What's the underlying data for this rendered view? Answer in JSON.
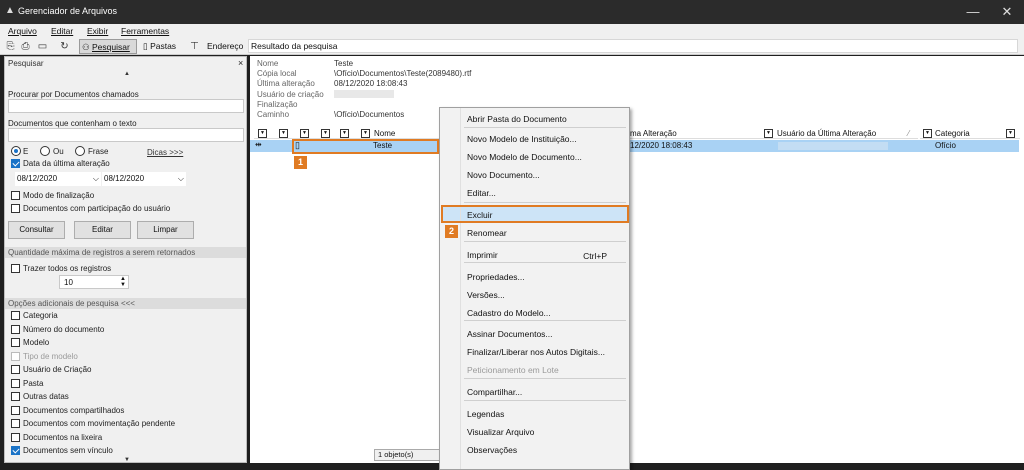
{
  "window": {
    "title": "Gerenciador de Arquivos"
  },
  "menubar": [
    "Arquivo",
    "Editar",
    "Exibir",
    "Ferramentas"
  ],
  "toolbar": {
    "search_label": "Pesquisar",
    "folders_label": "Pastas",
    "address_label": "Endereço",
    "address_value": "Resultado da pesquisa"
  },
  "search_panel": {
    "title": "Pesquisar",
    "close": "×",
    "name_label": "Procurar por Documentos chamados",
    "text_label": "Documentos que contenham o texto",
    "radio_and": "E",
    "radio_or": "Ou",
    "radio_phrase": "Frase",
    "tips": "Dicas >>>",
    "date_check": "Data da última alteração",
    "date_from": "08/12/2020",
    "date_to": "08/12/2020",
    "finalization_mode": "Modo de finalização",
    "user_docs": "Documentos com participação do usuário",
    "btn_query": "Consultar",
    "btn_edit": "Editar",
    "btn_clear": "Limpar",
    "max_records_title": "Quantidade máxima de registros a serem retornados",
    "all_records": "Trazer todos os registros",
    "max_records_value": "10",
    "extra_options_title": "Opções adicionais de pesquisa <<<",
    "extra_options": [
      {
        "label": "Categoria",
        "checked": false,
        "disabled": false
      },
      {
        "label": "Número do documento",
        "checked": false,
        "disabled": false
      },
      {
        "label": "Modelo",
        "checked": false,
        "disabled": false
      },
      {
        "label": "Tipo de modelo",
        "checked": false,
        "disabled": true
      },
      {
        "label": "Usuário de Criação",
        "checked": false,
        "disabled": false
      },
      {
        "label": "Pasta",
        "checked": false,
        "disabled": false
      },
      {
        "label": "Outras datas",
        "checked": false,
        "disabled": false
      },
      {
        "label": "Documentos compartilhados",
        "checked": false,
        "disabled": false
      },
      {
        "label": "Documentos com movimentação pendente",
        "checked": false,
        "disabled": false
      },
      {
        "label": "Documentos na lixeira",
        "checked": false,
        "disabled": false
      },
      {
        "label": "Documentos sem vínculo",
        "checked": true,
        "disabled": false
      }
    ]
  },
  "details": {
    "labels": [
      "Nome",
      "Cópia local",
      "Última alteração",
      "Usuário de criação",
      "Finalização",
      "Caminho"
    ],
    "values": [
      "Teste",
      "\\Ofício\\Documentos\\Teste(2089480).rtf",
      "08/12/2020 18:08:43",
      "",
      "",
      "\\Ofício\\Documentos"
    ]
  },
  "grid": {
    "col_name": "Nome",
    "col_last_change": "ma Alteração",
    "col_last_user": "Usuário da Última Alteração",
    "col_category": "Categoria",
    "row": {
      "name": "Teste",
      "last_change": "12/2020 18:08:43",
      "category": "Ofício"
    }
  },
  "status": {
    "count": "1 objeto(s)"
  },
  "context_menu": {
    "items": [
      "Abrir Pasta do Documento",
      "Novo Modelo de Instituição...",
      "Novo Modelo de Documento...",
      "Novo Documento...",
      "Editar...",
      "Excluir",
      "Renomear",
      "Imprimir",
      "Propriedades...",
      "Versões...",
      "Cadastro do Modelo...",
      "Assinar Documentos...",
      "Finalizar/Liberar nos Autos Digitais...",
      "Peticionamento em Lote",
      "Compartilhar...",
      "Legendas",
      "Visualizar Arquivo",
      "Observações"
    ],
    "print_shortcut": "Ctrl+P"
  },
  "annotations": {
    "badge1": "1",
    "badge2": "2"
  },
  "colors": {
    "highlight": "#e07b23",
    "selection": "#a9d2f4",
    "check": "#1a73c7"
  }
}
